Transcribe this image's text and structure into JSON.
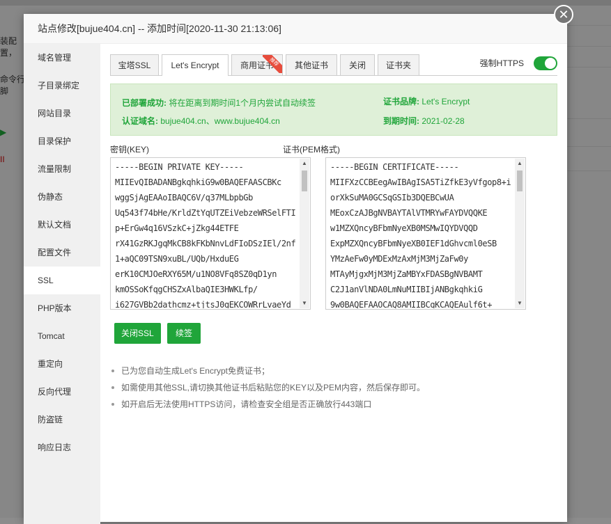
{
  "background": {
    "rows": [
      "装配置，",
      "命令行脚",
      "▶",
      "II"
    ]
  },
  "modal": {
    "title": "站点修改[bujue404.cn] -- 添加时间[2020-11-30 21:13:06]",
    "close_icon": "close-icon"
  },
  "sidebar": {
    "items": [
      {
        "label": "域名管理"
      },
      {
        "label": "子目录绑定"
      },
      {
        "label": "网站目录"
      },
      {
        "label": "目录保护"
      },
      {
        "label": "流量限制"
      },
      {
        "label": "伪静态"
      },
      {
        "label": "默认文档"
      },
      {
        "label": "配置文件"
      },
      {
        "label": "SSL"
      },
      {
        "label": "PHP版本"
      },
      {
        "label": "Tomcat"
      },
      {
        "label": "重定向"
      },
      {
        "label": "反向代理"
      },
      {
        "label": "防盗链"
      },
      {
        "label": "响应日志"
      }
    ],
    "active": "SSL"
  },
  "tabs": [
    {
      "label": "宝塔SSL"
    },
    {
      "label": "Let's Encrypt"
    },
    {
      "label": "商用证书",
      "badge": "推荐"
    },
    {
      "label": "其他证书"
    },
    {
      "label": "关闭"
    },
    {
      "label": "证书夹"
    }
  ],
  "force_https": {
    "label": "强制HTTPS",
    "enabled": true
  },
  "info": {
    "deployed_key": "已部署成功:",
    "deployed_val": "将在距离到期时间1个月内尝试自动续签",
    "brand_key": "证书品牌:",
    "brand_val": "Let's Encrypt",
    "domain_key": "认证域名:",
    "domain_val": "bujue404.cn、www.bujue404.cn",
    "expire_key": "到期时间:",
    "expire_val": "2021-02-28"
  },
  "key_label": "密钥(KEY)",
  "cert_label": "证书(PEM格式)",
  "key_text": "-----BEGIN PRIVATE KEY-----\nMIIEvQIBADANBgkqhkiG9w0BAQEFAASCBKc\nwggSjAgEAAoIBAQC6V/q37MLbpbGb\nUq543f74bHe/KrldZtYqUTZEiVebzeWRSelFTI\np+ErGw4q16VSzkC+jZkg44ETFE\nrX41GzRKJgqMkCB8kFKbNnvLdFIoDSzIEl/2nf\n1+aQC09TSN9xuBL/UQb/HxduEG\nerK10CMJOeRXY65M/u1NO8VFq8SZ0qD1yn\nkmOSSoKfqgCHSZxAlbaQIE3HWKLfp/\ni627GVBb2dathcmz+tjtsJ0gEKCOWRrLvaeYd",
  "cert_text": "-----BEGIN CERTIFICATE-----\nMIIFXzCCBEegAwIBAgISA5TiZfkE3yVfgop8+i\norXkSuMA0GCSqGSIb3DQEBCwUA\nMEoxCzAJBgNVBAYTAlVTMRYwFAYDVQQKE\nw1MZXQncyBFbmNyeXB0MSMwIQYDVQQD\nExpMZXQncyBFbmNyeXB0IEF1dGhvcml0eSB\nYMzAeFw0yMDExMzAxMjM3MjZaFw0y\nMTAyMjgxMjM3MjZaMBYxFDASBgNVBAMT\nC2J1anVlNDA0LmNuMIIBIjANBgkqhkiG\n9w0BAQEFAAOCAQ8AMIIBCgKCAQEAulf6t+",
  "buttons": {
    "close_ssl": "关闭SSL",
    "renew": "续签"
  },
  "tips": [
    "已为您自动生成Let's Encrypt免费证书；",
    "如需使用其他SSL,请切换其他证书后粘贴您的KEY以及PEM内容，然后保存即可。",
    "如开启后无法使用HTTPS访问，请检查安全组是否正确放行443端口"
  ],
  "colors": {
    "accent": "#20a53a",
    "info_bg": "#dff0d8"
  }
}
